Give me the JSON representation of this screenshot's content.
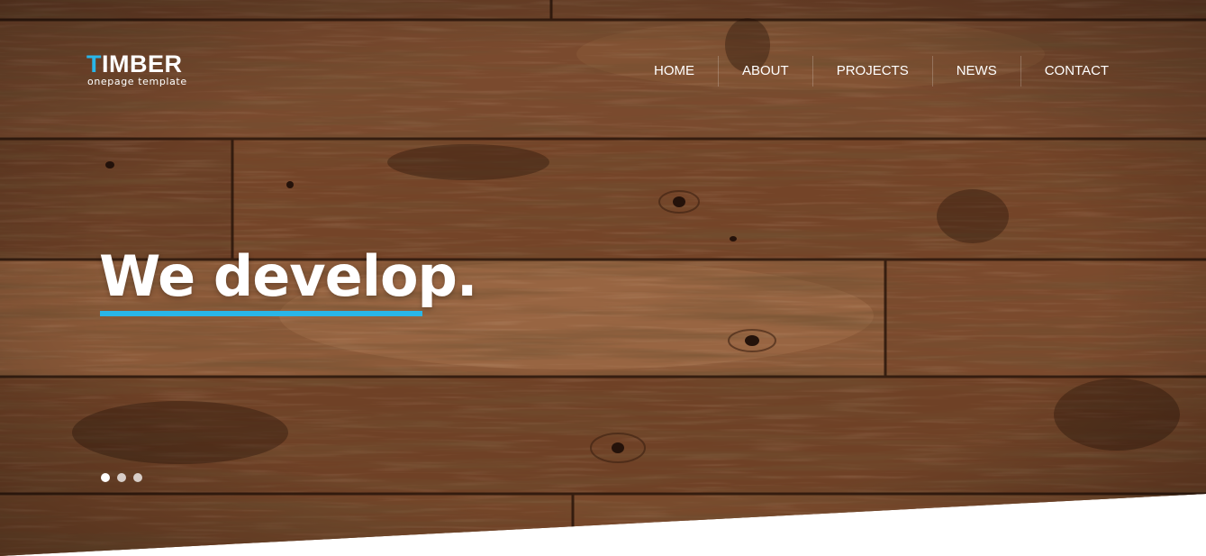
{
  "brand": {
    "title_accent": "T",
    "title_rest": "IMBER",
    "subtitle": "onepage template",
    "accent_color": "#29b6e8"
  },
  "nav": {
    "items": [
      {
        "label": "HOME"
      },
      {
        "label": "ABOUT"
      },
      {
        "label": "PROJECTS"
      },
      {
        "label": "NEWS"
      },
      {
        "label": "CONTACT"
      }
    ]
  },
  "hero": {
    "headline": "We develop.",
    "background": "wood-planks",
    "slides_total": 3,
    "active_slide": 1
  }
}
